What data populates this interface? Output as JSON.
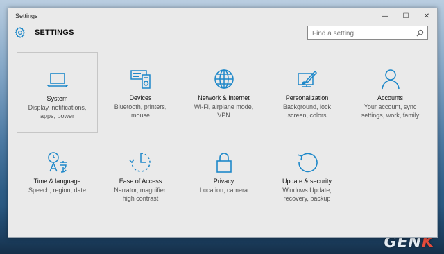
{
  "window": {
    "title": "Settings",
    "minimize": "—",
    "maximize": "☐",
    "close": "✕"
  },
  "header": {
    "title": "SETTINGS",
    "search_placeholder": "Find a setting"
  },
  "accent": "#1e88c9",
  "tiles": [
    {
      "name": "System",
      "desc": "Display, notifications,\napps, power",
      "icon": "laptop-icon"
    },
    {
      "name": "Devices",
      "desc": "Bluetooth, printers,\nmouse",
      "icon": "devices-icon"
    },
    {
      "name": "Network & Internet",
      "desc": "Wi-Fi, airplane mode,\nVPN",
      "icon": "globe-icon"
    },
    {
      "name": "Personalization",
      "desc": "Background, lock\nscreen, colors",
      "icon": "paint-icon"
    },
    {
      "name": "Accounts",
      "desc": "Your account, sync\nsettings, work, family",
      "icon": "person-icon"
    },
    {
      "name": "Time & language",
      "desc": "Speech, region, date",
      "icon": "time-language-icon"
    },
    {
      "name": "Ease of Access",
      "desc": "Narrator, magnifier,\nhigh contrast",
      "icon": "ease-of-access-icon"
    },
    {
      "name": "Privacy",
      "desc": "Location, camera",
      "icon": "lock-icon"
    },
    {
      "name": "Update & security",
      "desc": "Windows Update,\nrecovery, backup",
      "icon": "refresh-icon"
    }
  ],
  "watermark": {
    "text_main": "GEN",
    "text_last": "K"
  }
}
